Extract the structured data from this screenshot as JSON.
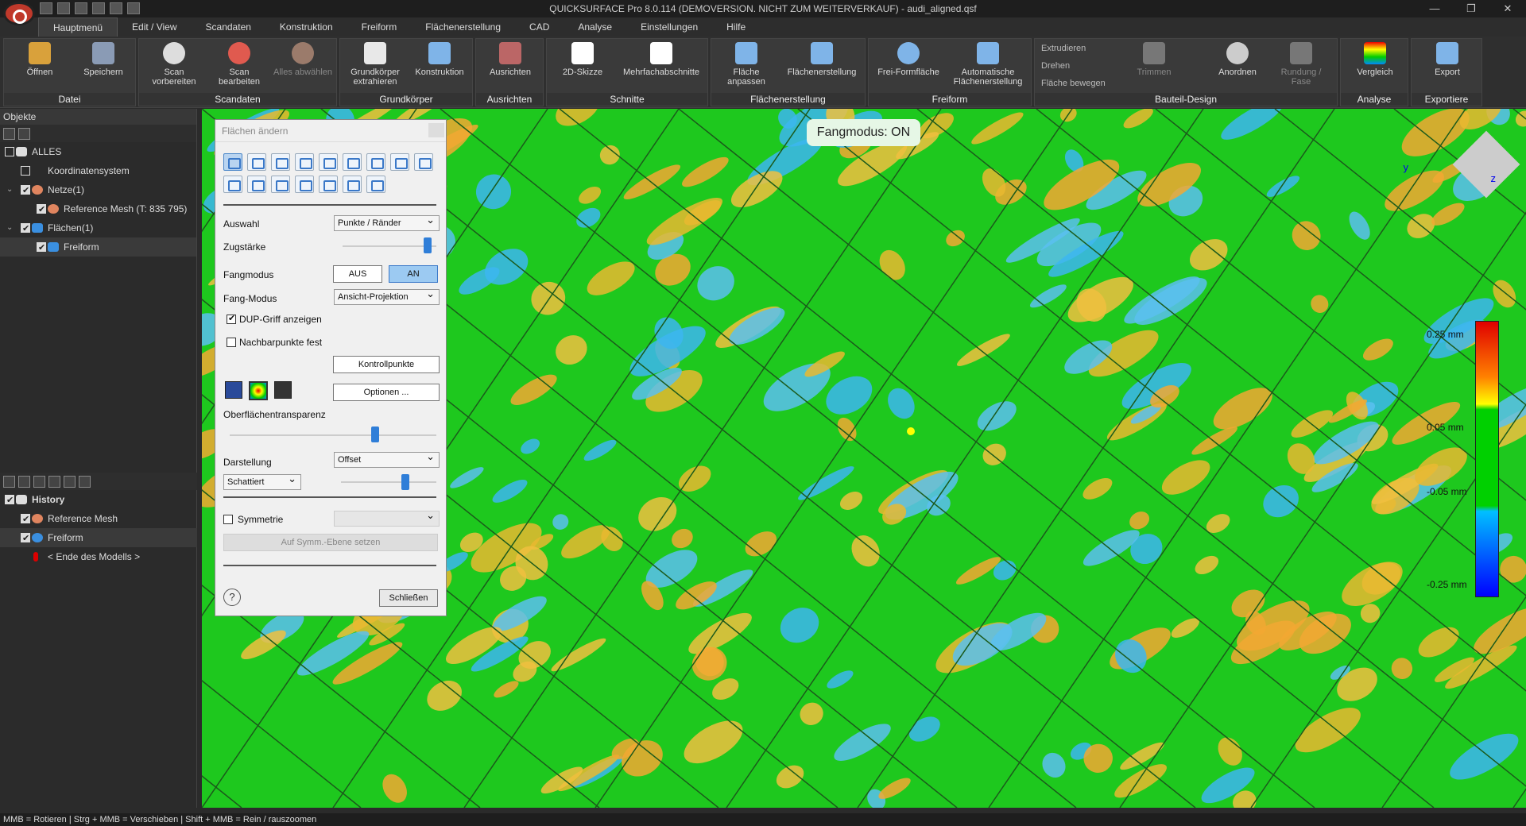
{
  "window": {
    "title": "QUICKSURFACE Pro 8.0.114 (DEMOVERSION. NICHT ZUM WEITERVERKAUF) - audi_aligned.qsf"
  },
  "menu": [
    "Hauptmenü",
    "Edit / View",
    "Scandaten",
    "Konstruktion",
    "Freiform",
    "Flächenerstellung",
    "CAD",
    "Analyse",
    "Einstellungen",
    "Hilfe"
  ],
  "ribbon": {
    "datei": {
      "label": "Datei",
      "open": "Öffnen",
      "save": "Speichern"
    },
    "scandaten": {
      "label": "Scandaten",
      "prepare": "Scan vorbereiten",
      "edit": "Scan bearbeiten",
      "deselect": "Alles abwählen"
    },
    "grundkoerper": {
      "label": "Grundkörper",
      "extract": "Grundkörper extrahieren",
      "construct": "Konstruktion"
    },
    "ausrichten": {
      "label": "Ausrichten",
      "align": "Ausrichten"
    },
    "schnitte": {
      "label": "Schnitte",
      "sketch": "2D-Skizze",
      "multi": "Mehrfachabschnitte"
    },
    "flaechen": {
      "label": "Flächenerstellung",
      "fit": "Fläche anpassen",
      "create": "Flächenerstellung"
    },
    "freiform": {
      "label": "Freiform",
      "free": "Frei-Formfläche",
      "auto": "Automatische Flächenerstellung"
    },
    "bauteil": {
      "label": "Bauteil-Design",
      "extrude": "Extrudieren",
      "rotate": "Drehen",
      "move": "Fläche bewegen",
      "trim": "Trimmen",
      "arrange": "Anordnen",
      "fillet": "Rundung / Fase"
    },
    "analyse": {
      "label": "Analyse",
      "compare": "Vergleich"
    },
    "export": {
      "label": "Exportiere",
      "export": "Export"
    }
  },
  "objects": {
    "header": "Objekte",
    "items": [
      {
        "label": "ALLES"
      },
      {
        "label": "Koordinatensystem"
      },
      {
        "label": "Netze(1)"
      },
      {
        "label": "Reference Mesh (T: 835 795)"
      },
      {
        "label": "Flächen(1)"
      },
      {
        "label": "Freiform"
      }
    ]
  },
  "history": {
    "header": "History",
    "items": [
      {
        "label": "Reference Mesh"
      },
      {
        "label": "Freiform"
      },
      {
        "label": "< Ende des Modells >"
      }
    ]
  },
  "viewport": {
    "badge": "Fangmodus: ON",
    "legend": [
      "0.25 mm",
      "0.05 mm",
      "-0.05 mm",
      "-0.25 mm"
    ],
    "axes": {
      "y": "y",
      "z": "z"
    }
  },
  "dialog": {
    "title": "Flächen ändern",
    "auswahl_label": "Auswahl",
    "auswahl_value": "Punkte / Ränder",
    "zug_label": "Zugstärke",
    "fang_label": "Fangmodus",
    "aus": "AUS",
    "an": "AN",
    "fangmodus_label": "Fang-Modus",
    "fangmodus_value": "Ansicht-Projektion",
    "dup": "DUP-Griff anzeigen",
    "nachbar": "Nachbarpunkte fest",
    "kontroll": "Kontrollpunkte",
    "optionen": "Optionen ...",
    "transparenz": "Oberflächentransparenz",
    "darstellung_label": "Darstellung",
    "darstellung_value": "Offset",
    "shading_value": "Schattiert",
    "symmetrie": "Symmetrie",
    "symm_btn": "Auf Symm.-Ebene setzen",
    "help": "?",
    "close": "Schließen"
  },
  "status": "MMB = Rotieren | Strg + MMB = Verschieben | Shift + MMB = Rein / rauszoomen"
}
